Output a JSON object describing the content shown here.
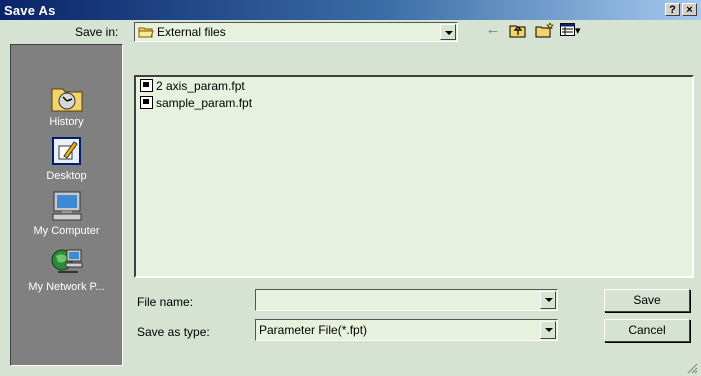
{
  "window": {
    "title": "Save As",
    "help_glyph": "?",
    "close_glyph": "×"
  },
  "save_in": {
    "label": "Save in:",
    "value": "External files"
  },
  "toolbar": {
    "back_glyph": "←",
    "view_arrow": "▾"
  },
  "places": [
    {
      "label": "History"
    },
    {
      "label": "Desktop"
    },
    {
      "label": "My Computer"
    },
    {
      "label": "My Network P..."
    }
  ],
  "files": [
    {
      "name": "2 axis_param.fpt"
    },
    {
      "name": "sample_param.fpt"
    }
  ],
  "file_name": {
    "label": "File name:",
    "value": ""
  },
  "save_as_type": {
    "label": "Save as type:",
    "value": "Parameter File(*.fpt)"
  },
  "buttons": {
    "save": "Save",
    "cancel": "Cancel"
  },
  "colors": {
    "title_start": "#0a246a",
    "title_end": "#a6caf0",
    "window_bg": "#d6e2d2",
    "field_bg": "#e6f2dd",
    "places_bg": "#808080"
  }
}
